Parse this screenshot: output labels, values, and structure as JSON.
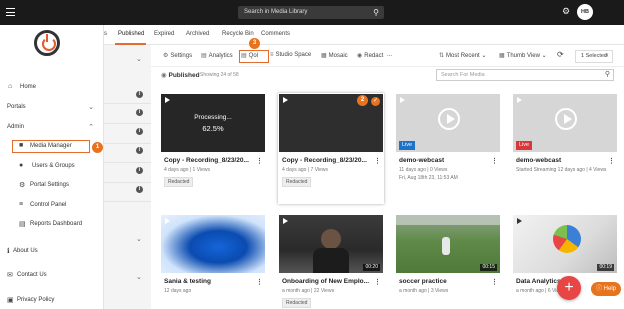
{
  "topbar": {
    "search_placeholder": "Search in Media Library",
    "avatar_initials": "HB"
  },
  "sidebar": {
    "home": "Home",
    "portals": "Portals",
    "admin": "Admin",
    "media_manager": "Media Manager",
    "users_groups": "Users & Groups",
    "portal_settings": "Portal Settings",
    "control_panel": "Control Panel",
    "reports_dashboard": "Reports Dashboard",
    "about_us": "About Us",
    "contact_us": "Contact Us",
    "privacy_policy": "Privacy Policy"
  },
  "tabs": [
    "Published",
    "Expired",
    "Archived",
    "Recycle Bin",
    "Comments"
  ],
  "tab_partial": "s",
  "toolbar": {
    "settings": "Settings",
    "analytics": "Analytics",
    "qoi": "QoI",
    "studio_space": "Studio Space",
    "mosaic": "Mosaic",
    "redact": "Redact",
    "more": "...",
    "sort": "Most Recent",
    "view": "Thumb View",
    "selected": "1 Selected"
  },
  "status": {
    "title": "Published",
    "count": "Showing 24 of 58",
    "search_placeholder": "Search For Media"
  },
  "badges": {
    "b1": "1",
    "b2": "2",
    "b3": "3"
  },
  "cards": [
    {
      "title": "Copy - Recording_8/23/20...",
      "meta": "4 days ago  |  1 Views",
      "tag": "Redacted",
      "processing": "Processing...",
      "percent": "62.5%"
    },
    {
      "title": "Copy - Recording_8/23/20...",
      "meta": "4 days ago  |  7 Views",
      "tag": "Redacted"
    },
    {
      "title": "demo-webcast",
      "meta": "11 days ago  |  0 Views",
      "meta2": "Fri, Aug 18th 23, 11:53 AM",
      "live": "Live"
    },
    {
      "title": "demo-webcast",
      "meta": "Started Streaming 12 days ago  |  4 Views",
      "live": "Live"
    },
    {
      "title": "Sania & testing",
      "meta": "12 days ago"
    },
    {
      "title": "Onboarding of New Emplo...",
      "meta": "a month ago  |  22 Views",
      "tag": "Redacted",
      "duration": "00:20"
    },
    {
      "title": "soccer practice",
      "meta": "a month ago  |  3 Views",
      "duration": "00:15"
    },
    {
      "title": "Data Analytics",
      "meta": "a month ago  |  6 Views",
      "duration": "00:19"
    }
  ],
  "help": "Help",
  "colors": {
    "accent": "#e36b2e",
    "live": "#1e73c8",
    "live_red": "#d9383a",
    "fab": "#e84545"
  }
}
